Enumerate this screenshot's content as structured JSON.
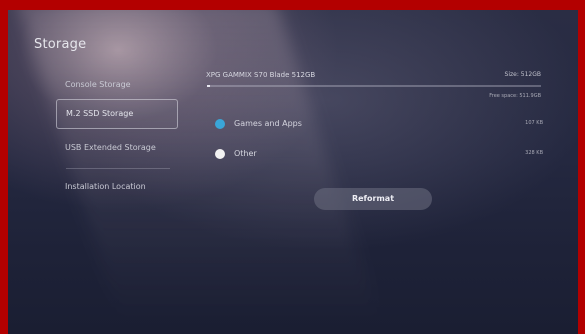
{
  "page": {
    "title": "Storage"
  },
  "sidebar": {
    "items": [
      {
        "label": "Console Storage",
        "selected": false
      },
      {
        "label": "M.2 SSD Storage",
        "selected": true
      },
      {
        "label": "USB Extended Storage",
        "selected": false
      },
      {
        "label": "Installation Location",
        "selected": false
      }
    ]
  },
  "drive": {
    "name": "XPG GAMMIX S70 Blade 512GB",
    "size_label": "Size: 512GB",
    "free_space_label": "Free space: 511.9GB",
    "used_fraction": 0.01
  },
  "legend": [
    {
      "label": "Games and Apps",
      "value": "107 KB",
      "color": "#3aa6d8"
    },
    {
      "label": "Other",
      "value": "328 KB",
      "color": "#f2f2f2"
    }
  ],
  "actions": {
    "reformat_label": "Reformat"
  },
  "colors": {
    "frame": "#b30000",
    "background": "#242840",
    "games_and_apps": "#3aa6d8",
    "other": "#f2f2f2"
  }
}
